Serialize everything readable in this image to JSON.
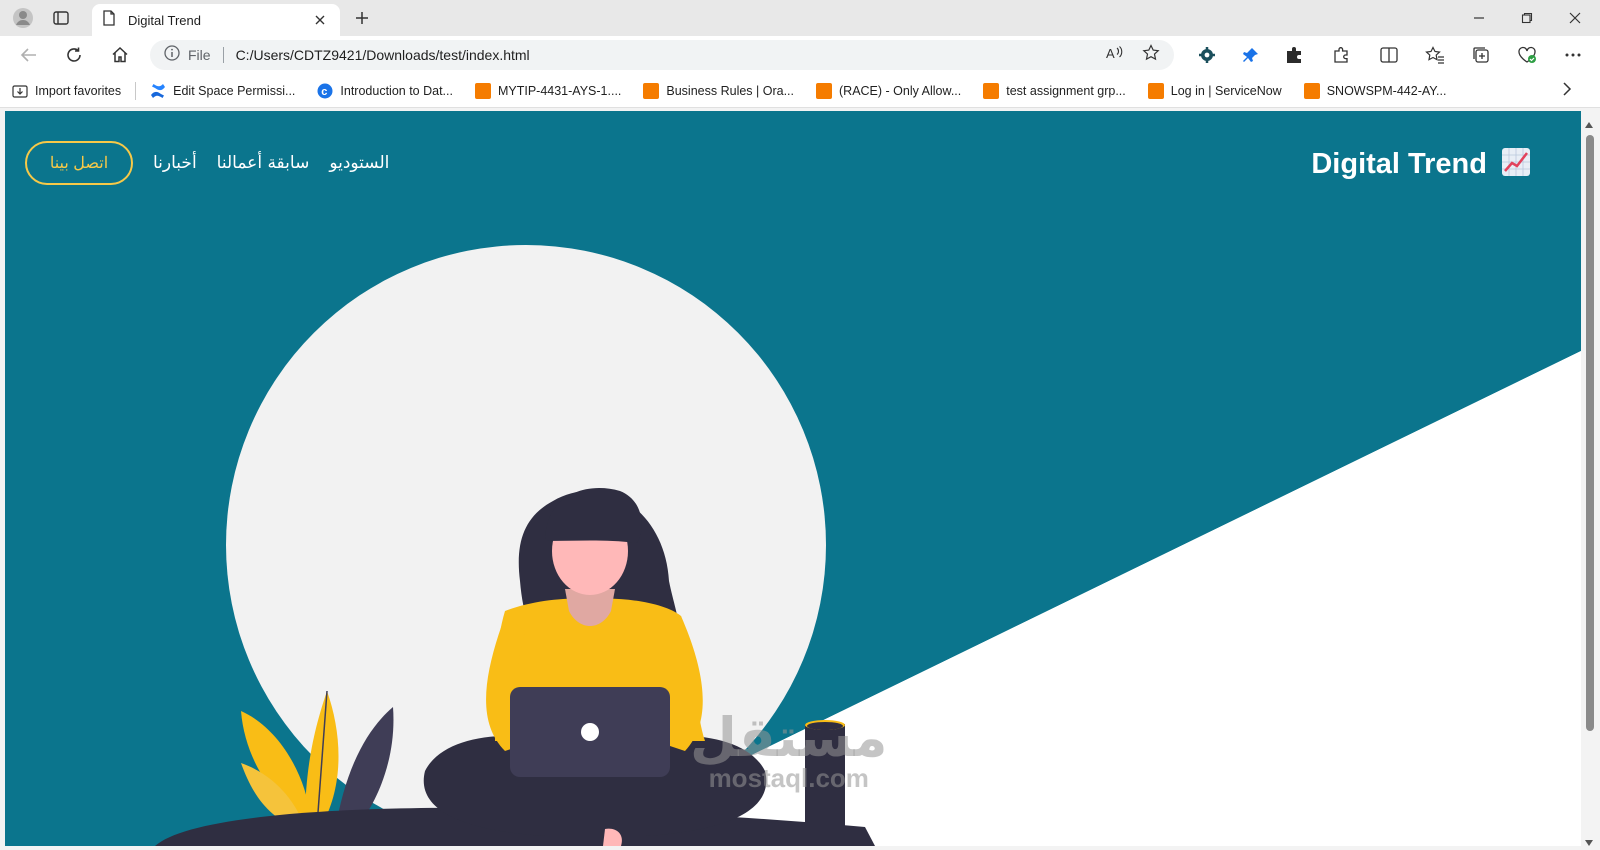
{
  "browser": {
    "tab_title": "Digital Trend",
    "url_scheme_label": "File",
    "url": "C:/Users/CDTZ9421/Downloads/test/index.html"
  },
  "bookmarks": [
    {
      "label": "Import favorites",
      "icon": "import-icon"
    },
    {
      "label": "Edit Space Permissi...",
      "icon": "confluence-icon"
    },
    {
      "label": "Introduction to Dat...",
      "icon": "c-logo-icon"
    },
    {
      "label": "MYTIP-4431-AYS-1....",
      "icon": "orange-bookmark-icon"
    },
    {
      "label": "Business Rules | Ora...",
      "icon": "orange-bookmark-icon"
    },
    {
      "label": "(RACE) - Only Allow...",
      "icon": "orange-bookmark-icon"
    },
    {
      "label": "test assignment grp...",
      "icon": "orange-bookmark-icon"
    },
    {
      "label": "Log in | ServiceNow",
      "icon": "orange-bookmark-icon"
    },
    {
      "label": "SNOWSPM-442-AY...",
      "icon": "orange-bookmark-icon"
    }
  ],
  "site": {
    "brand": "Digital Trend",
    "brand_icon": "chart-increasing-icon",
    "cta_label": "اتصل بينا",
    "nav": [
      "الستوديو",
      "سابقة أعمالنا",
      "أخبارنا"
    ]
  },
  "watermark": {
    "arabic": "مستقل",
    "latin": "mostaql.com"
  },
  "colors": {
    "hero_teal": "#0b758d",
    "accent_yellow": "#f7c948",
    "shirt_yellow": "#f9bd16",
    "dark": "#2f2e41"
  }
}
